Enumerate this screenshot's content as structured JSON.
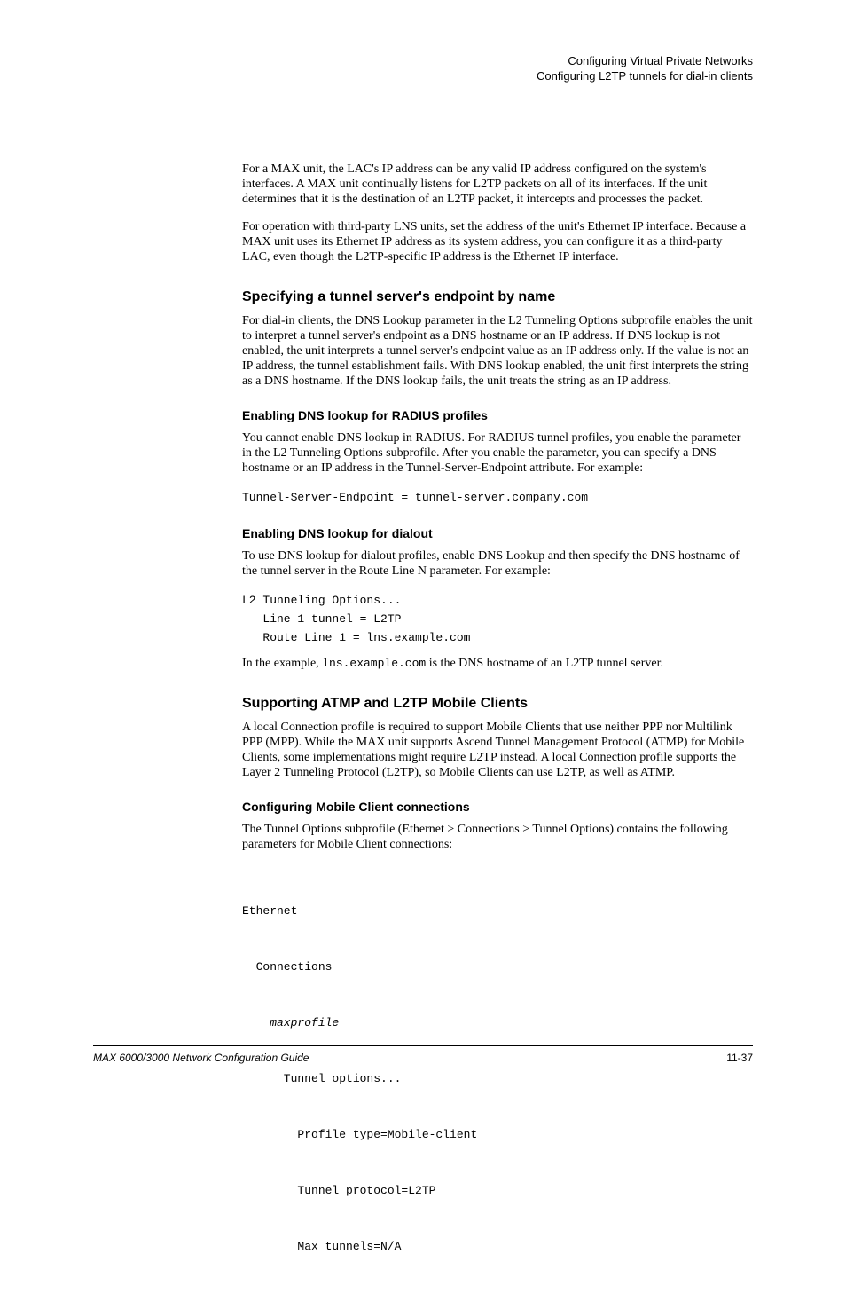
{
  "header": {
    "line1": "Configuring Virtual Private Networks",
    "line2": "Configuring L2TP tunnels for dial-in clients"
  },
  "p1": "For a MAX unit, the LAC's IP address can be any valid IP address configured on the system's interfaces. A MAX unit continually listens for L2TP packets on all of its interfaces. If the unit determines that it is the destination of an L2TP packet, it intercepts and processes the packet.",
  "p2": "For operation with third-party LNS units, set the address of the unit's Ethernet IP interface. Because a MAX unit uses its Ethernet IP address as its system address, you can configure it as a third-party LAC, even though the L2TP-specific IP address is the Ethernet IP interface.",
  "h3a": "Specifying a tunnel server's endpoint by name",
  "p3": "For dial-in clients, the DNS Lookup parameter in the L2 Tunneling Options subprofile enables the unit to interpret a tunnel server's endpoint as a DNS hostname or an IP address. If DNS lookup is not enabled, the unit interprets a tunnel server's endpoint value as an IP address only. If the value is not an IP address, the tunnel establishment fails. With DNS lookup enabled, the unit first interprets the string as a DNS hostname. If the DNS lookup fails, the unit treats the string as an IP address.",
  "h4a": "Enabling DNS lookup for RADIUS profiles",
  "p4": "You cannot enable DNS lookup in RADIUS. For RADIUS tunnel profiles, you enable the parameter in the L2 Tunneling Options subprofile. After you enable the parameter, you can specify a DNS hostname or an IP address in the Tunnel-Server-Endpoint attribute. For example:",
  "code1": "Tunnel-Server-Endpoint = tunnel-server.company.com",
  "h4b": "Enabling DNS lookup for dialout",
  "p5": "To use DNS lookup for dialout profiles, enable DNS Lookup and then specify the DNS hostname of the tunnel server in the Route Line N parameter. For example:",
  "code2": "L2 Tunneling Options...\n   Line 1 tunnel = L2TP\n   Route Line 1 = lns.example.com",
  "p6_pre": "In the example, ",
  "p6_code": "lns.example.com",
  "p6_post": " is the DNS hostname of an L2TP tunnel server.",
  "h3b": "Supporting ATMP and L2TP Mobile Clients",
  "p7": "A local Connection profile is required to support Mobile Clients that use neither PPP nor Multilink PPP (MPP). While the MAX unit supports Ascend Tunnel Management Protocol (ATMP) for Mobile Clients, some implementations might require L2TP instead. A local Connection profile supports the Layer 2 Tunneling Protocol (L2TP), so Mobile Clients can use L2TP, as well as ATMP.",
  "h4c": "Configuring Mobile Client connections",
  "p8": "The Tunnel Options subprofile (Ethernet > Connections > Tunnel Options) contains the following parameters for Mobile Client connections:",
  "code3_l1": "Ethernet",
  "code3_l2": "  Connections",
  "code3_l3_italic": "    maxprofile",
  "code3_l4": "      Tunnel options...",
  "code3_l5": "        Profile type=Mobile-client",
  "code3_l6": "        Tunnel protocol=L2TP",
  "code3_l7": "        Max tunnels=N/A",
  "footer": {
    "left": "MAX 6000/3000 Network Configuration Guide",
    "right": "11-37"
  }
}
